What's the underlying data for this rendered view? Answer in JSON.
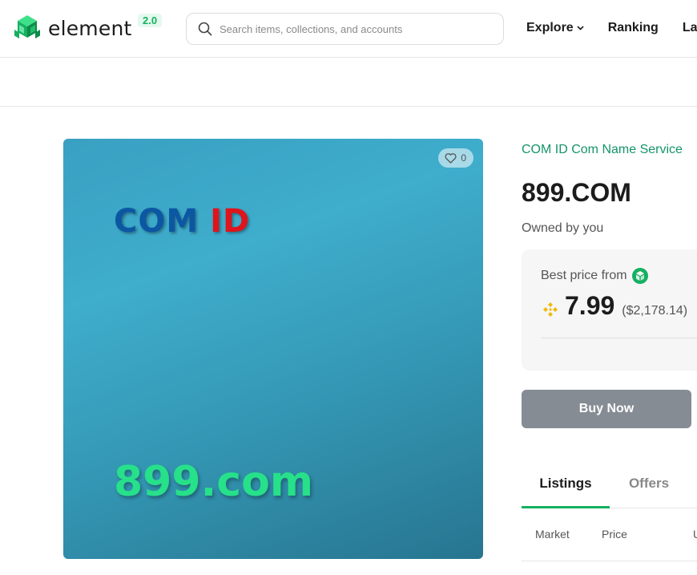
{
  "header": {
    "logo_text": "element",
    "version": "2.0",
    "search_placeholder": "Search items, collections, and accounts",
    "nav": [
      "Explore",
      "Ranking",
      "Lau"
    ]
  },
  "artwork": {
    "like_count": "0",
    "brand_com": "COM",
    "brand_id": "ID",
    "domain_text": "899.com"
  },
  "item": {
    "collection": "COM ID Com Name Service",
    "title": "899.COM",
    "owner": "Owned by you"
  },
  "price_card": {
    "best_price_label": "Best price from",
    "price": "7.99",
    "usd": "($2,178.14)",
    "currency_icon": "bnb-icon",
    "marketplace_icon": "element-market-icon"
  },
  "buy_button": "Buy Now",
  "tabs": [
    "Listings",
    "Offers"
  ],
  "table_columns": [
    "Market",
    "Price",
    "U"
  ],
  "colors": {
    "brand_green": "#15b061",
    "collection_link": "#15956a",
    "buy_button": "#868c94",
    "bnb_yellow": "#f0b90b"
  }
}
